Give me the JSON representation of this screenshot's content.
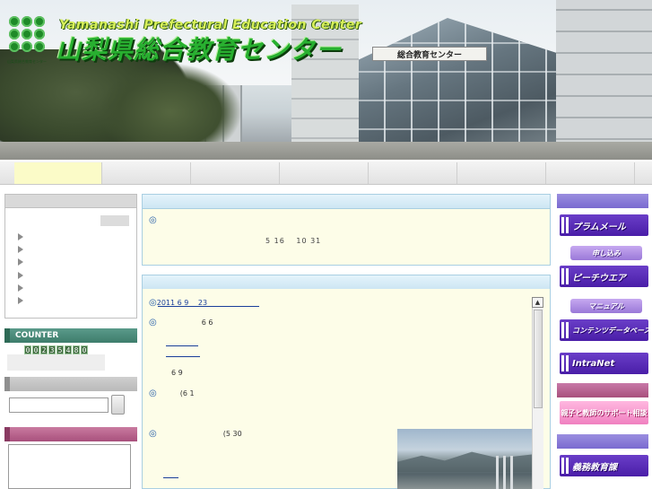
{
  "header": {
    "title_en": "Yamanashi Prefectural Education Center",
    "title_jp": "山梨県総合教育センター",
    "logo_caption": "山梨県総合教育センター",
    "building_sign": "総合教育センター"
  },
  "nav": {
    "items": [
      "",
      "",
      "",
      "",
      "",
      "",
      "",
      ""
    ],
    "active_index": 0
  },
  "sidebar": {
    "counter_label": "COUNTER",
    "counter_digits": [
      "0",
      "0",
      "2",
      "3",
      "5",
      "4",
      "8",
      "0"
    ],
    "search_placeholder": ""
  },
  "notice": {
    "bullet": "◎",
    "date_text": "5 16　 10 31"
  },
  "news": {
    "scroll_up_glyph": "▲",
    "items": [
      {
        "bullet": "◎",
        "text": "2011 6 9　 23"
      },
      {
        "bullet": "◎",
        "text": "6 6"
      },
      {
        "bullet": "",
        "text": "6 9"
      },
      {
        "bullet": "◎",
        "text": "(6 1"
      },
      {
        "bullet": "◎",
        "text": "(5 30"
      }
    ]
  },
  "right_banners": [
    {
      "label": "プラムメール",
      "style": "purple"
    },
    {
      "label": "申し込み",
      "style": "small"
    },
    {
      "label": "ピーチウエア",
      "style": "purple"
    },
    {
      "label": "マニュアル",
      "style": "small"
    },
    {
      "label": "コンテンツデータベース",
      "style": "purple"
    },
    {
      "label": "IntraNet",
      "style": "purple"
    },
    {
      "label": "親子と教師のサポート相談",
      "style": "pink"
    },
    {
      "label": "義務教育課",
      "style": "purple"
    }
  ],
  "colors": {
    "title_green": "#28b030",
    "nav_active": "#fbfbc8",
    "center_header": "#cde6f3",
    "content_bg": "#fdfde8",
    "counter_green": "#3e7d6c",
    "pink_head": "#a8507c",
    "banner_purple": "#4a1ea8"
  }
}
